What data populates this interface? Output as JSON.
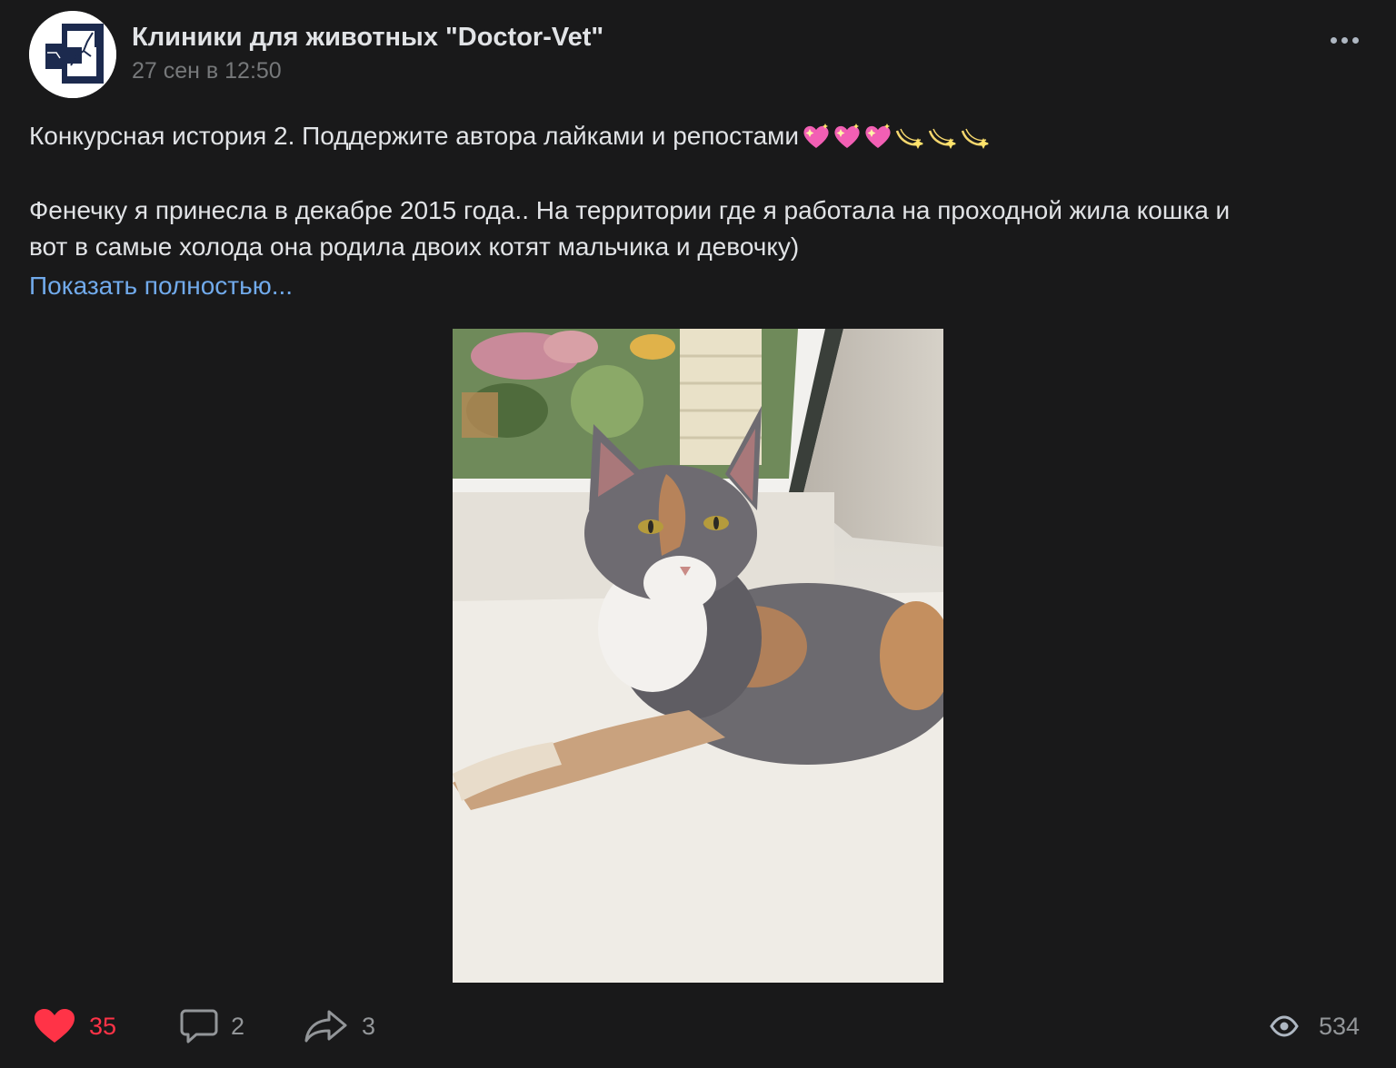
{
  "post": {
    "author": "Клиники для животных \"Doctor-Vet\"",
    "date": "27 сен в 12:50",
    "title_line": "Конкурсная история 2. Поддержите автора лайками и репостами",
    "title_emojis": [
      "sparkling-heart-emoji",
      "sparkling-heart-emoji",
      "sparkling-heart-emoji",
      "dizzy-emoji",
      "dizzy-emoji",
      "dizzy-emoji"
    ],
    "paragraph_line1": "Фенечку я принесла в декабре 2015 года.. На территории где я работала на проходной жила кошка и",
    "paragraph_line2": "вот в самые холода она родила двоих котят мальчика и девочку)",
    "show_more": "Показать полностью..."
  },
  "actions": {
    "likes": "35",
    "comments": "2",
    "shares": "3",
    "views": "534"
  },
  "colors": {
    "background": "#19191a",
    "text": "#e1e3e6",
    "muted": "#76787a",
    "link": "#71aaeb",
    "like": "#ff3347",
    "icon": "#aeb7c2"
  },
  "icons": {
    "more": "more-dots-icon",
    "like": "heart-icon",
    "comment": "comment-icon",
    "share": "share-arrow-icon",
    "views": "eye-icon"
  }
}
